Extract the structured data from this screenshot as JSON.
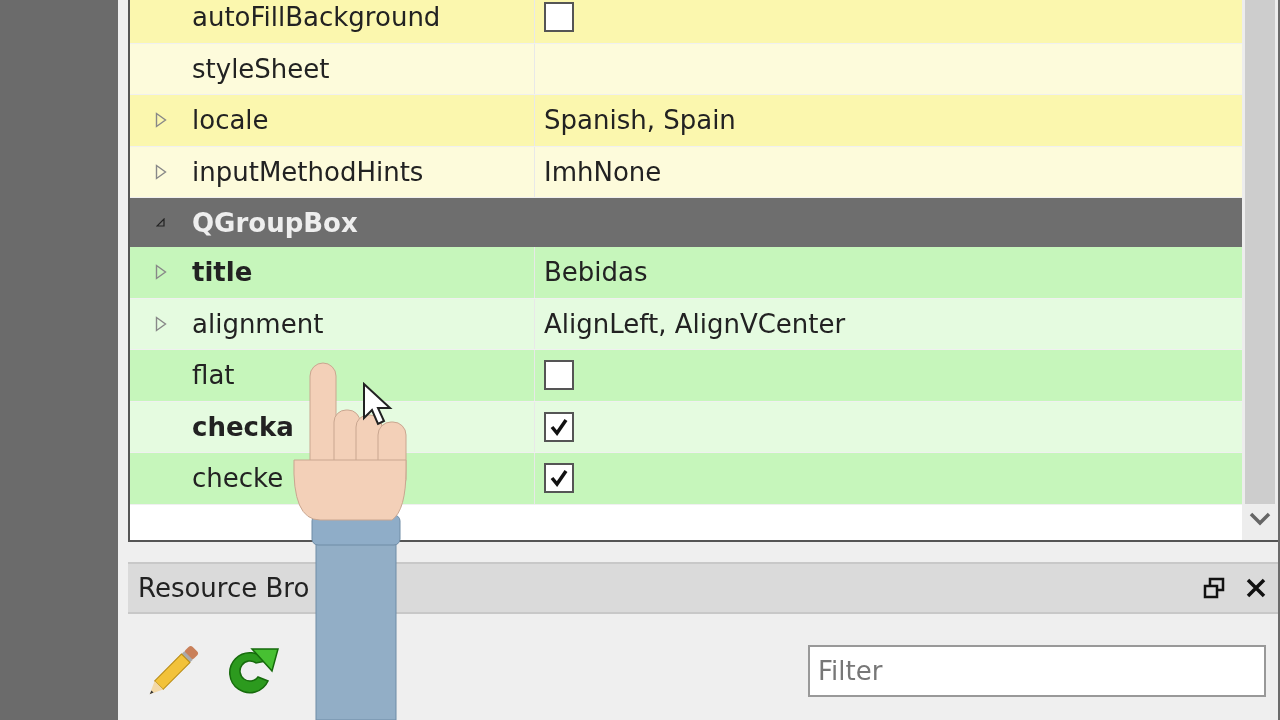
{
  "property_editor": {
    "sections": [
      {
        "kind": "rows",
        "color": "#fbf7ae",
        "rows": [
          {
            "kind": "checkbox",
            "name": "autoFillBackground",
            "modified": false,
            "expandable": false,
            "checked": false
          },
          {
            "kind": "blank",
            "name": "styleSheet",
            "modified": false,
            "expandable": false
          },
          {
            "kind": "text",
            "name": "locale",
            "modified": false,
            "expandable": true,
            "value": "Spanish, Spain"
          },
          {
            "kind": "text",
            "name": "inputMethodHints",
            "modified": false,
            "expandable": true,
            "value": "ImhNone"
          }
        ]
      },
      {
        "kind": "header",
        "title": "QGroupBox",
        "expanded": true
      },
      {
        "kind": "rows",
        "color": "#c6f6bb",
        "rows": [
          {
            "kind": "text",
            "name": "title",
            "modified": true,
            "expandable": true,
            "value": "Bebidas"
          },
          {
            "kind": "text",
            "name": "alignment",
            "modified": false,
            "expandable": true,
            "value": "AlignLeft, AlignVCenter"
          },
          {
            "kind": "checkbox",
            "name": "flat",
            "modified": false,
            "expandable": false,
            "checked": false
          },
          {
            "kind": "checkbox",
            "name": "checka",
            "modified": true,
            "expandable": false,
            "checked": true
          },
          {
            "kind": "checkbox",
            "name": "checke",
            "modified": false,
            "expandable": false,
            "checked": true
          }
        ]
      }
    ]
  },
  "resource_browser": {
    "title": "Resource Bro",
    "filter": {
      "placeholder": "Filter"
    }
  }
}
